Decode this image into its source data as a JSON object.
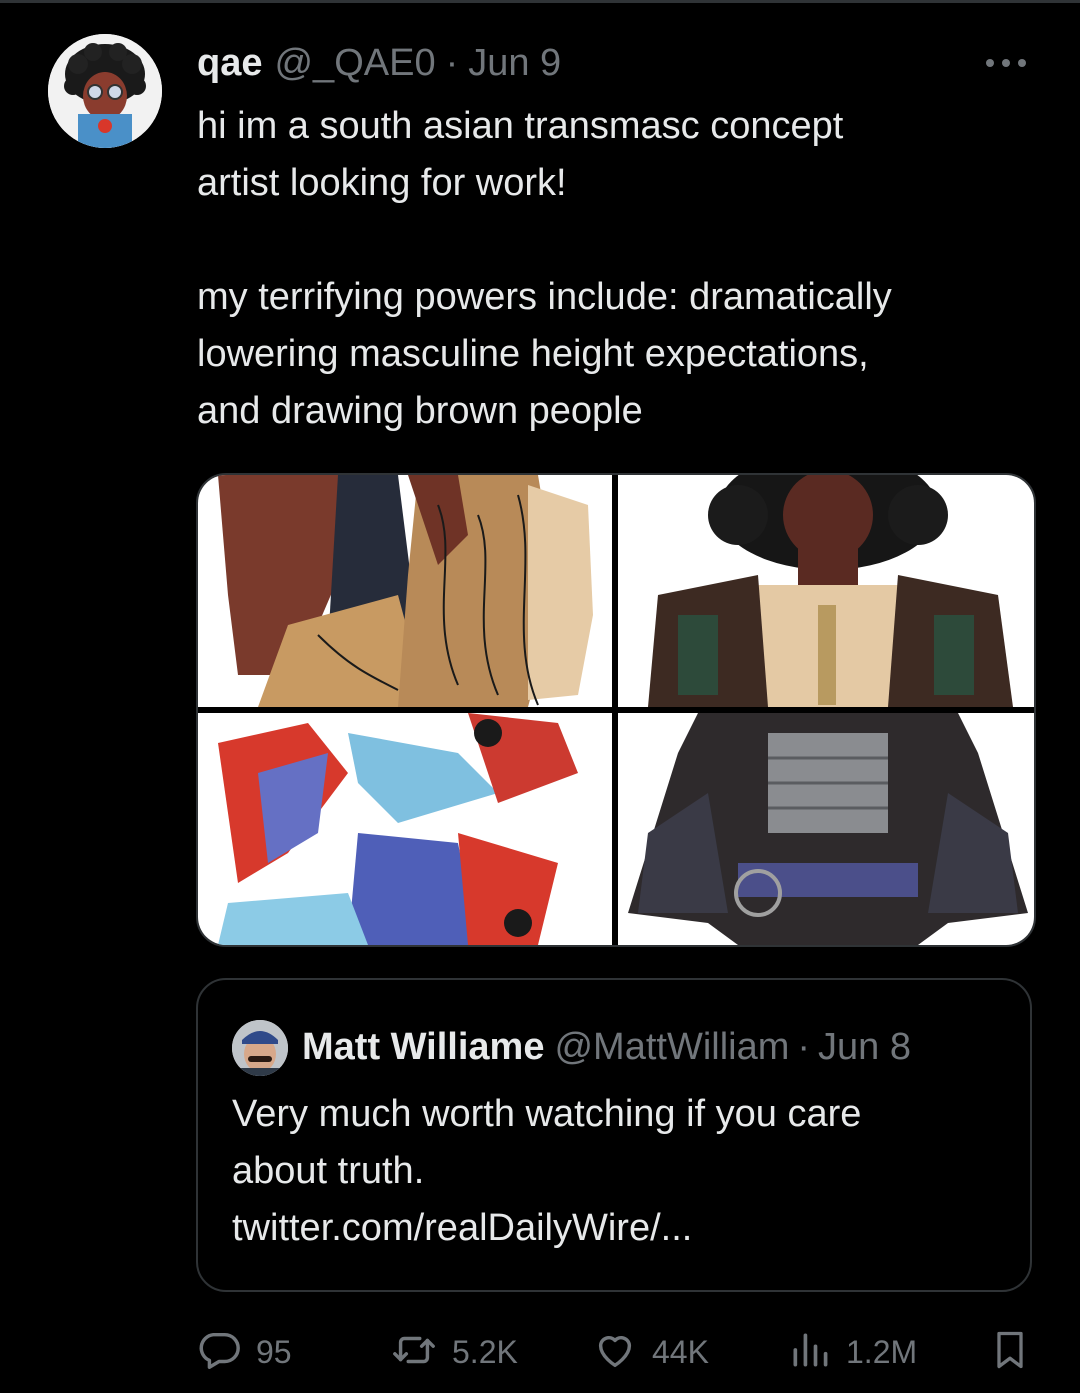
{
  "tweet": {
    "author_name": "qae",
    "handle": "@_QAE0",
    "separator": "·",
    "date": "Jun 9",
    "text_paragraphs": [
      [
        "hi im a south asian transmasc concept",
        "artist looking for work!"
      ],
      [
        "my terrifying powers include: dramatically",
        "lowering masculine height expectations,",
        "and drawing brown people"
      ]
    ]
  },
  "quoted_tweet": {
    "author_name": "Matt Williame",
    "handle": "@MattWilliam",
    "separator": "·",
    "date": "Jun 8",
    "text_lines": [
      "Very much worth watching if you care",
      "about truth.",
      "twitter.com/realDailyWire/..."
    ]
  },
  "actions": {
    "replies": "95",
    "reposts": "5.2K",
    "likes": "44K",
    "views": "1.2M"
  },
  "colors": {
    "background": "#000000",
    "text_primary": "#e7e9ea",
    "text_secondary": "#71767b",
    "border": "#2f3336"
  },
  "icons": [
    "more-icon",
    "reply-icon",
    "repost-icon",
    "like-icon",
    "views-icon",
    "bookmark-icon"
  ]
}
